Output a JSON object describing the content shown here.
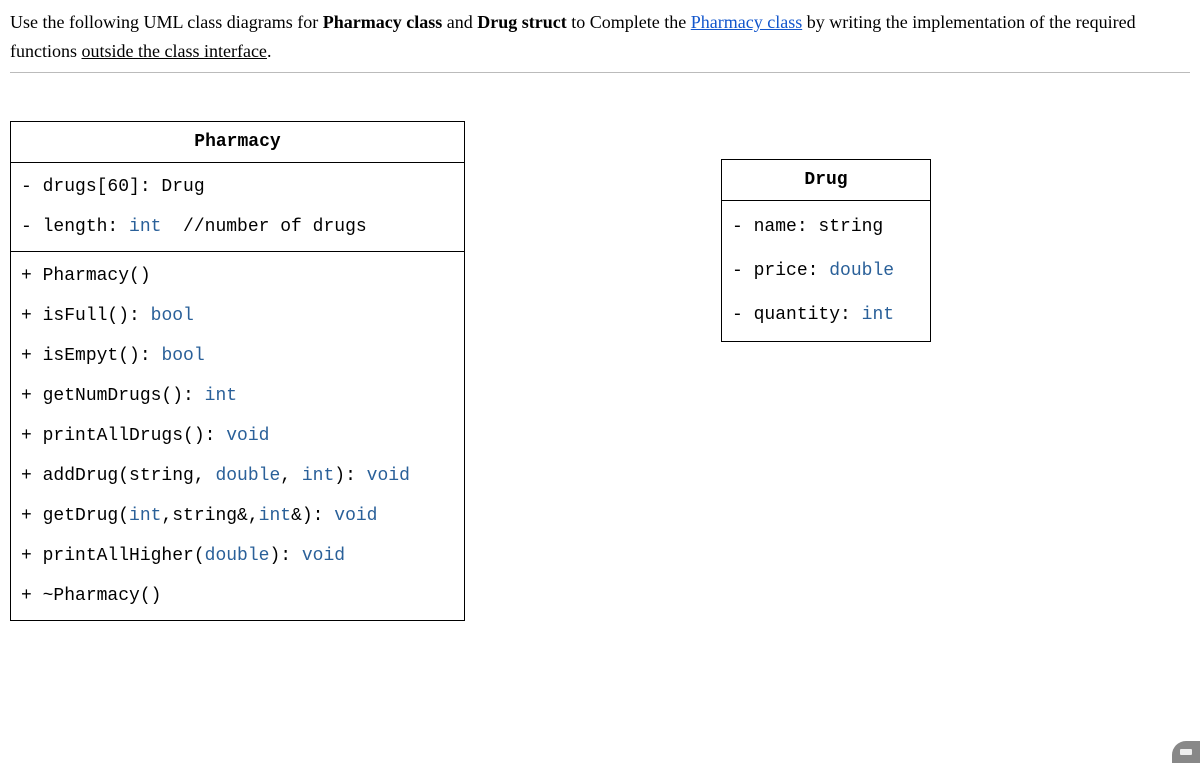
{
  "instruction": {
    "pre": "Use the following UML class diagrams for ",
    "bold1": "Pharmacy class",
    "mid1": " and ",
    "bold2": "Drug struct",
    "mid2": " to Complete the ",
    "link": "Pharmacy class",
    "mid3": " by writing the implementation of the required functions ",
    "underline": "outside the class interface",
    "end": "."
  },
  "pharmacy": {
    "title": "Pharmacy",
    "attrs": {
      "a0": {
        "vis": "- ",
        "name": "drugs[60]: Drug"
      },
      "a1": {
        "vis": "- ",
        "name": "length: ",
        "type": "int",
        "comment": "  //number of drugs"
      }
    },
    "ops": {
      "o0": {
        "vis": "+ ",
        "sig": "Pharmacy()"
      },
      "o1": {
        "vis": "+ ",
        "sig": "isFull(): ",
        "t1": "bool"
      },
      "o2": {
        "vis": "+ ",
        "sig": "isEmpyt(): ",
        "t1": "bool"
      },
      "o3": {
        "vis": "+ ",
        "sig": "getNumDrugs(): ",
        "t1": "int"
      },
      "o4": {
        "vis": "+ ",
        "sig": "printAllDrugs(): ",
        "t1": "void"
      },
      "o5": {
        "vis": "+ ",
        "sig": "addDrug(string, ",
        "t1": "double",
        "mid1": ", ",
        "t2": "int",
        "mid2": "): ",
        "t3": "void"
      },
      "o6": {
        "vis": "+ ",
        "sig": "getDrug(",
        "t1": "int",
        "mid1": ",string&,",
        "t2": "int",
        "mid2": "&): ",
        "t3": "void"
      },
      "o7": {
        "vis": "+ ",
        "sig": "printAllHigher(",
        "t1": "double",
        "mid1": "): ",
        "t2": "void"
      },
      "o8": {
        "vis": "+ ",
        "sig": "~Pharmacy()"
      }
    }
  },
  "drug": {
    "title": "Drug",
    "attrs": {
      "a0": {
        "vis": "- ",
        "name": "name: string"
      },
      "a1": {
        "vis": "- ",
        "name": "price: ",
        "type": "double"
      },
      "a2": {
        "vis": "- ",
        "name": "quantity: ",
        "type": "int"
      }
    }
  }
}
